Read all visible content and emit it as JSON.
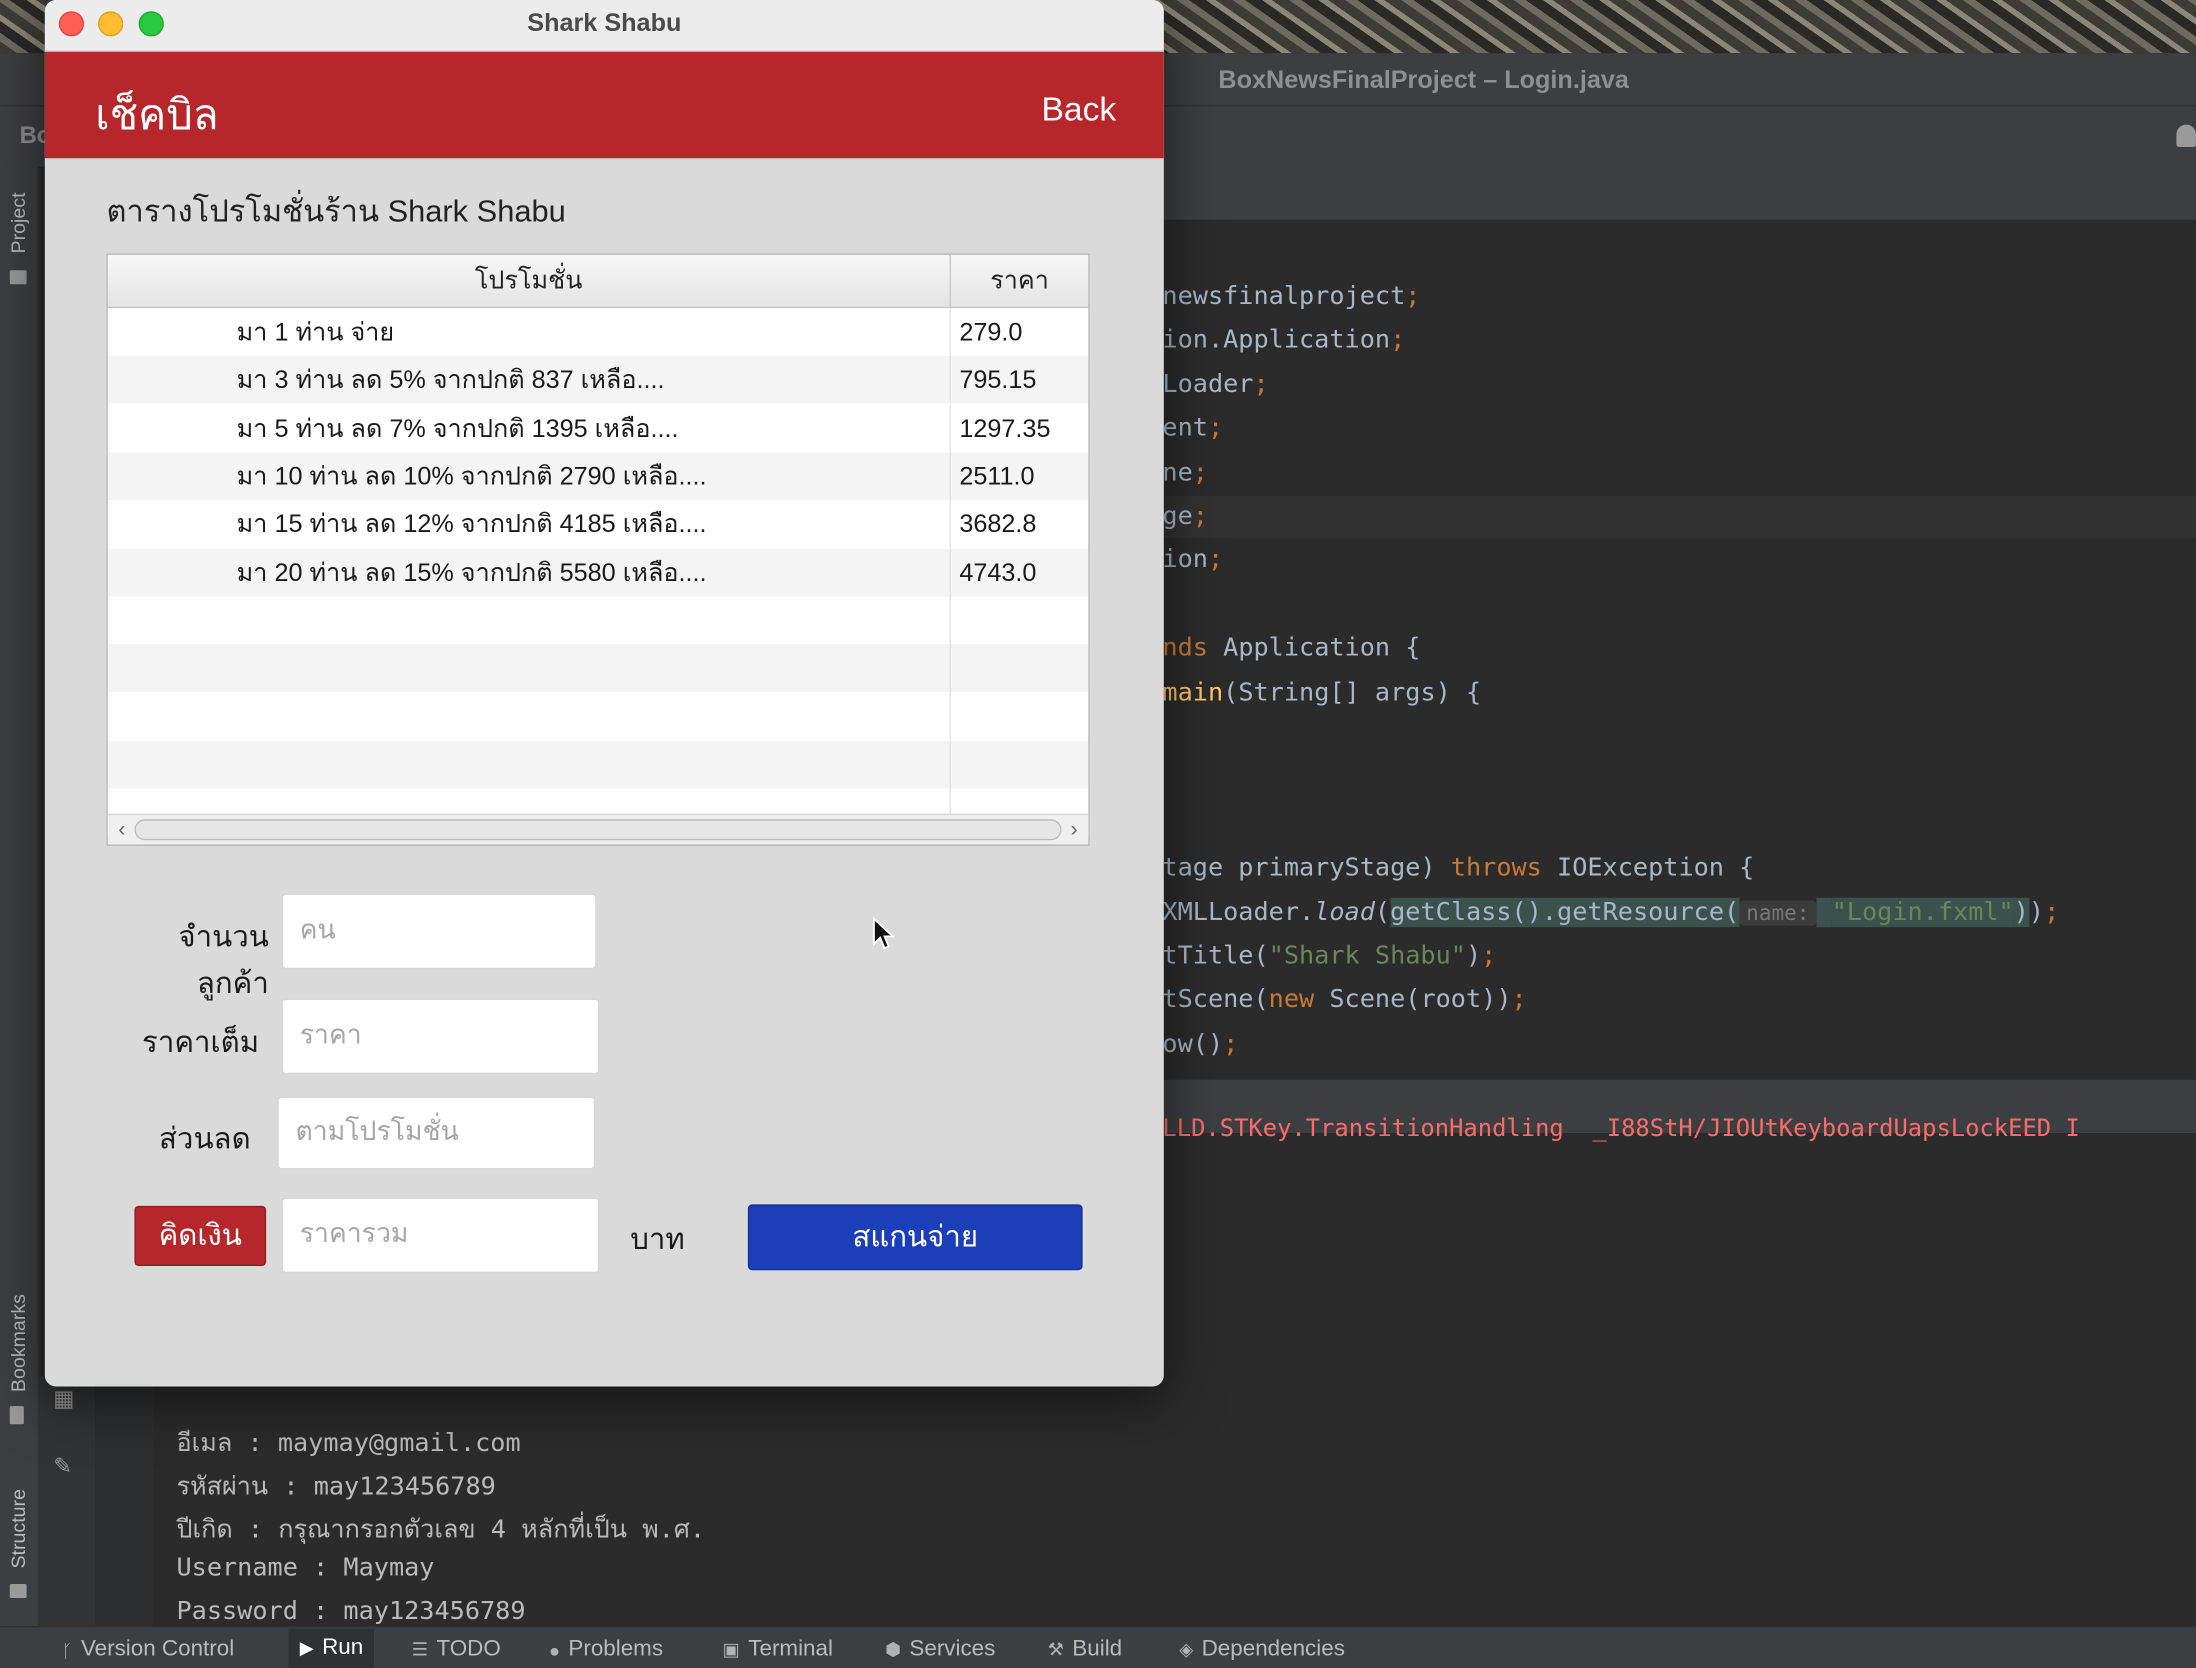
{
  "ide": {
    "window_title": "BoxNewsFinalProject – Login.java",
    "toolbar_project_abbrev": "Bo",
    "left_strip": {
      "project_label": "Project",
      "bookmarks_label": "Bookmarks",
      "structure_label": "Structure"
    },
    "code_lines": [
      {
        "segments": [
          {
            "t": "newsfinalproject",
            "c": "plain"
          },
          {
            "t": ";",
            "c": "kw"
          }
        ]
      },
      {
        "segments": [
          {
            "t": "ion.Application",
            "c": "plain"
          },
          {
            "t": ";",
            "c": "kw"
          }
        ]
      },
      {
        "segments": [
          {
            "t": "Loader",
            "c": "plain"
          },
          {
            "t": ";",
            "c": "kw"
          }
        ]
      },
      {
        "segments": [
          {
            "t": "ent",
            "c": "plain"
          },
          {
            "t": ";",
            "c": "kw"
          }
        ]
      },
      {
        "segments": [
          {
            "t": "ne",
            "c": "plain"
          },
          {
            "t": ";",
            "c": "kw"
          }
        ]
      },
      {
        "segments": [
          {
            "t": "ge",
            "c": "plain"
          },
          {
            "t": ";",
            "c": "kw"
          }
        ],
        "highlight": true
      },
      {
        "segments": [
          {
            "t": "ion",
            "c": "plain"
          },
          {
            "t": ";",
            "c": "kw"
          }
        ]
      },
      {
        "segments": []
      },
      {
        "segments": [
          {
            "t": "nds ",
            "c": "kw"
          },
          {
            "t": "Application {",
            "c": "plain"
          }
        ]
      },
      {
        "segments": [
          {
            "t": "main",
            "c": "fn"
          },
          {
            "t": "(String[] args) {",
            "c": "plain"
          }
        ]
      },
      {
        "segments": []
      },
      {
        "segments": []
      },
      {
        "segments": []
      },
      {
        "segments": [
          {
            "t": "tage primaryStage) ",
            "c": "plain"
          },
          {
            "t": "throws ",
            "c": "kw"
          },
          {
            "t": "IOException {",
            "c": "plain"
          }
        ]
      },
      {
        "segments": [
          {
            "t": "XMLLoader.",
            "c": "plain"
          },
          {
            "t": "load",
            "c": "it"
          },
          {
            "t": "(",
            "c": "plain"
          },
          {
            "t": "getClass().getResource(",
            "c": "paren"
          },
          {
            "t": "name:",
            "c": "hint"
          },
          {
            "t": " ",
            "c": "paren"
          },
          {
            "t": "\"Login.fxml\"",
            "c": "strhl"
          },
          {
            "t": ")",
            "c": "paren"
          },
          {
            "t": ")",
            "c": "plain"
          },
          {
            "t": ";",
            "c": "kw"
          }
        ]
      },
      {
        "segments": [
          {
            "t": "tTitle(",
            "c": "plain"
          },
          {
            "t": "\"Shark Shabu\"",
            "c": "str"
          },
          {
            "t": ")",
            "c": "plain"
          },
          {
            "t": ";",
            "c": "kw"
          }
        ]
      },
      {
        "segments": [
          {
            "t": "tScene(",
            "c": "plain"
          },
          {
            "t": "new ",
            "c": "kw"
          },
          {
            "t": "Scene(root))",
            "c": "plain"
          },
          {
            "t": ";",
            "c": "kw"
          }
        ]
      },
      {
        "segments": [
          {
            "t": "ow()",
            "c": "plain"
          },
          {
            "t": ";",
            "c": "kw"
          }
        ]
      }
    ],
    "error_line": "LLD.STKey.TransitionHandling  _I88StH/JIOUtKeyboardUapsLockEED I",
    "console_lines": [
      "อีเมล : maymay@gmail.com",
      "รหัสผ่าน : may123456789",
      "ปีเกิด : กรุณากรอกตัวเลข 4 หลักที่เป็น พ.ศ.",
      "Username : Maymay",
      "Password : may123456789"
    ],
    "statusbar": [
      {
        "label": "Version Control",
        "icon": "branch-icon"
      },
      {
        "label": "Run",
        "icon": "run-icon",
        "active": true
      },
      {
        "label": "TODO",
        "icon": "list-icon"
      },
      {
        "label": "Problems",
        "icon": "warning-icon"
      },
      {
        "label": "Terminal",
        "icon": "terminal-icon"
      },
      {
        "label": "Services",
        "icon": "services-icon"
      },
      {
        "label": "Build",
        "icon": "hammer-icon"
      },
      {
        "label": "Dependencies",
        "icon": "layers-icon"
      }
    ]
  },
  "app": {
    "window_title": "Shark Shabu",
    "header": {
      "title": "เช็คบิล",
      "back_label": "Back",
      "color": "#b6272c"
    },
    "section_title": "ตารางโปรโมชั่นร้าน Shark Shabu",
    "table": {
      "columns": [
        "โปรโมชั่น",
        "ราคา"
      ],
      "rows": [
        {
          "promo": "มา 1 ท่าน จ่าย",
          "price": "279.0"
        },
        {
          "promo": "มา 3 ท่าน ลด 5% จากปกติ  837  เหลือ....",
          "price": "795.15"
        },
        {
          "promo": "มา 5 ท่าน ลด 7% จากปกติ  1395  เหลือ....",
          "price": "1297.35"
        },
        {
          "promo": "มา 10 ท่าน ลด 10% จากปกติ  2790  เหลือ....",
          "price": "2511.0"
        },
        {
          "promo": "มา 15 ท่าน ลด 12% จากปกติ  4185  เหลือ....",
          "price": "3682.8"
        },
        {
          "promo": "มา 20 ท่าน ลด 15% จากปกติ  5580  เหลือ....",
          "price": "4743.0"
        }
      ],
      "empty_rows": 5
    },
    "form": {
      "customers_label": "จำนวนลูกค้า",
      "customers_placeholder": "คน",
      "full_price_label": "ราคาเต็ม",
      "full_price_placeholder": "ราคา",
      "discount_label": "ส่วนลด",
      "discount_placeholder": "ตามโปรโมชั่น",
      "calc_button": "คิดเงิน",
      "total_placeholder": "ราคารวม",
      "currency_label": "บาท",
      "scan_pay_button": "สแกนจ่าย",
      "scan_button_color": "#1b3fb9"
    }
  }
}
